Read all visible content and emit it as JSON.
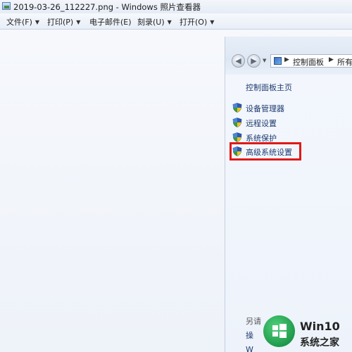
{
  "window": {
    "title": "2019-03-26_112227.png - Windows 照片查看器"
  },
  "menu": [
    {
      "label": "文件(F)"
    },
    {
      "label": "打印(P)"
    },
    {
      "label": "电子邮件(E)"
    },
    {
      "label": "刻录(U)"
    },
    {
      "label": "打开(O)"
    }
  ],
  "embedded": {
    "address": {
      "crumb1": "控制面板",
      "crumb2": "所有"
    },
    "sidebar": {
      "home": "控制面板主页",
      "links": [
        {
          "label": "设备管理器"
        },
        {
          "label": "远程设置"
        },
        {
          "label": "系统保护"
        },
        {
          "label": "高级系统设置",
          "highlighted": true
        }
      ],
      "see_also": "另请",
      "bottom1": "操",
      "bottom2": "W"
    }
  },
  "watermark": {
    "line1": "Win10",
    "line2": "系统之家"
  },
  "colors": {
    "highlight": "#e01919",
    "link": "#1e3a6e",
    "watermark_green": "#1f9a4c"
  }
}
